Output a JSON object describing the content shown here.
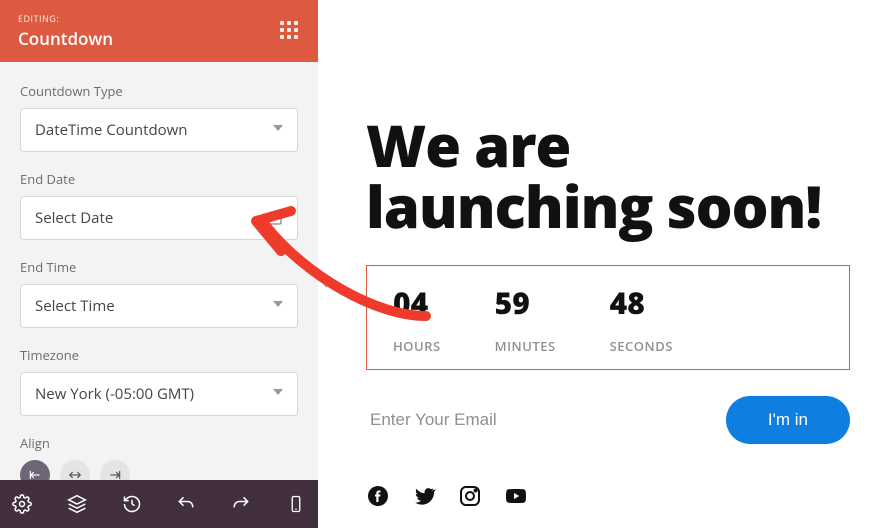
{
  "panel": {
    "editing_label": "EDITING:",
    "title": "Countdown",
    "fields": {
      "type_label": "Countdown Type",
      "type_value": "DateTime Countdown",
      "end_date_label": "End Date",
      "end_date_value": "Select Date",
      "end_time_label": "End Time",
      "end_time_value": "Select Time",
      "timezone_label": "Timezone",
      "timezone_value": "New York (-05:00 GMT)",
      "align_label": "Align"
    }
  },
  "preview": {
    "headline_line1": "We are",
    "headline_line2": "launching soon!",
    "countdown": {
      "hours": "04",
      "minutes": "59",
      "seconds": "48",
      "hours_label": "HOURS",
      "minutes_label": "MINUTES",
      "seconds_label": "SECONDS"
    },
    "email_placeholder": "Enter Your Email",
    "submit_label": "I'm in"
  },
  "colors": {
    "accent": "#dd5a40",
    "button": "#0e7fe1"
  }
}
